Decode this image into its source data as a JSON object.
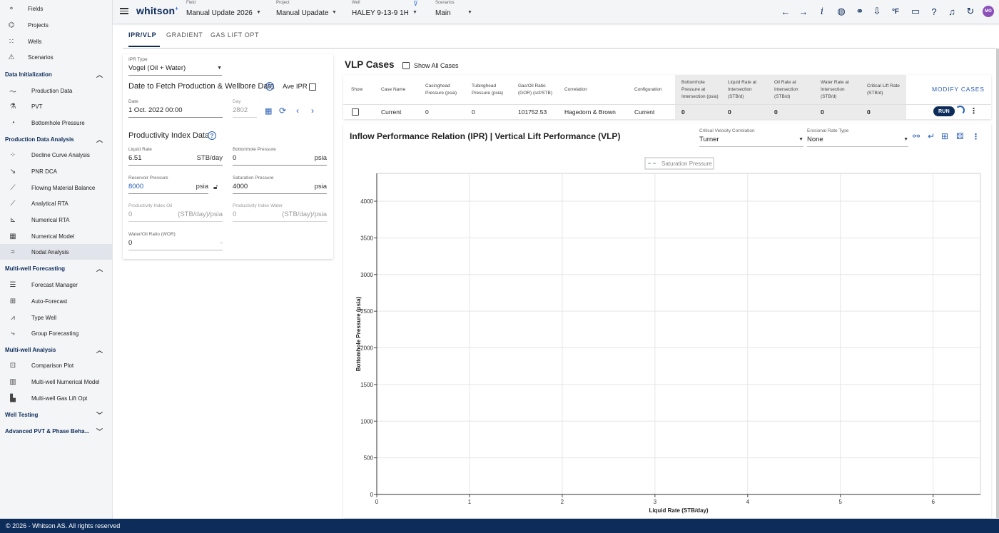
{
  "app": {
    "logo": "whitson",
    "logo_sup": "+"
  },
  "sidebar": {
    "items": [
      {
        "label": "Fields",
        "icon": "nodes-icon",
        "glyph": "⚬"
      },
      {
        "label": "Projects",
        "icon": "network-icon",
        "glyph": "⌬"
      },
      {
        "label": "Wells",
        "icon": "grid-dots-icon",
        "glyph": "⁙"
      },
      {
        "label": "Scenarios",
        "icon": "tree-icon",
        "glyph": "⚠"
      }
    ],
    "sections": [
      {
        "label": "Data Initialization",
        "expanded": true,
        "items": [
          {
            "label": "Production Data",
            "icon": "trend-icon",
            "glyph": "〜"
          },
          {
            "label": "PVT",
            "icon": "flask-icon",
            "glyph": "⚗"
          },
          {
            "label": "Bottomhole Pressure",
            "icon": "gauge-icon",
            "glyph": "◔"
          }
        ]
      },
      {
        "label": "Production Data Analysis",
        "expanded": true,
        "items": [
          {
            "label": "Decline Curve Analysis",
            "icon": "scatter-icon",
            "glyph": "⁘"
          },
          {
            "label": "PNR DCA",
            "icon": "decline-icon",
            "glyph": "↘"
          },
          {
            "label": "Flowing Material Balance",
            "icon": "chart-icon",
            "glyph": "⟋"
          },
          {
            "label": "Analytical RTA",
            "icon": "line-icon",
            "glyph": "⟋"
          },
          {
            "label": "Numerical RTA",
            "icon": "axes-icon",
            "glyph": "⊾"
          },
          {
            "label": "Numerical Model",
            "icon": "building-icon",
            "glyph": "▦"
          },
          {
            "label": "Nodal Analysis",
            "icon": "nodal-icon",
            "glyph": "≈"
          }
        ]
      },
      {
        "label": "Multi-well Forecasting",
        "expanded": true,
        "items": [
          {
            "label": "Forecast Manager",
            "icon": "list-icon",
            "glyph": "☰"
          },
          {
            "label": "Auto-Forecast",
            "icon": "grid-icon",
            "glyph": "⊞"
          },
          {
            "label": "Type Well",
            "icon": "typewell-icon",
            "glyph": "⩘"
          },
          {
            "label": "Group Forecasting",
            "icon": "group-icon",
            "glyph": "⤷"
          }
        ]
      },
      {
        "label": "Multi-well Analysis",
        "expanded": true,
        "items": [
          {
            "label": "Comparison Plot",
            "icon": "compare-icon",
            "glyph": "⊡"
          },
          {
            "label": "Multi-well Numerical Model",
            "icon": "model-icon",
            "glyph": "▥"
          },
          {
            "label": "Multi-well Gas Lift Opt",
            "icon": "gaslift-icon",
            "glyph": "▙"
          }
        ]
      },
      {
        "label": "Well Testing",
        "expanded": false,
        "items": []
      },
      {
        "label": "Advanced PVT & Phase Beha...",
        "expanded": false,
        "items": []
      }
    ],
    "active": "Nodal Analysis"
  },
  "topbar": {
    "field": {
      "caption": "Field",
      "value": "Manual Update 2026"
    },
    "project": {
      "caption": "Project",
      "value": "Manual Upadate"
    },
    "well": {
      "caption": "Well",
      "value": "HALEY 9-13-9 1H"
    },
    "scenario": {
      "caption": "Scenarios",
      "value": "Main"
    },
    "user_initials": "MO",
    "icons": [
      "arrow-left-icon",
      "arrow-right-icon",
      "info-icon",
      "globe-icon",
      "link-icon",
      "download-icon",
      "unit-icon",
      "feedback-icon",
      "help-icon",
      "bell-icon",
      "refresh-icon"
    ],
    "unit_label": "°F"
  },
  "tabs": [
    {
      "label": "IPR/VLP",
      "active": true
    },
    {
      "label": "GRADIENT",
      "active": false
    },
    {
      "label": "GAS LIFT OPT",
      "active": false
    }
  ],
  "ipr": {
    "ipr_type": {
      "caption": "IPR Type",
      "value": "Vogel (Oil + Water)"
    },
    "fetch_title": "Date to Fetch Production & Wellbore Data",
    "ave_ipr_label": "Ave IPR",
    "date": {
      "caption": "Date",
      "value": "1 Oct. 2022 00:00"
    },
    "day": {
      "caption": "Day",
      "value": "2802"
    },
    "pi_title": "Productivity Index Data",
    "liquid_rate": {
      "caption": "Liquid Rate",
      "value": "6.51",
      "unit": "STB/day"
    },
    "bhp": {
      "caption": "Bottomhole Pressure",
      "value": "0",
      "unit": "psia"
    },
    "reservoir_pressure": {
      "caption": "Reservoir Pressure",
      "value": "8000",
      "unit": "psia"
    },
    "saturation_pressure": {
      "caption": "Saturation Pressure",
      "value": "4000",
      "unit": "psia"
    },
    "pi_oil": {
      "caption": "Productivity Index Oil",
      "value": "0",
      "unit": "(STB/day)/psia"
    },
    "pi_water": {
      "caption": "Productivity Index Water",
      "value": "0",
      "unit": "(STB/day)/psia"
    },
    "wor": {
      "caption": "Water/Oil Ratio (WOR)",
      "value": "0",
      "unit": "-"
    }
  },
  "vlp": {
    "title": "VLP Cases",
    "show_all_label": "Show All Cases",
    "modify_label": "MODIFY CASES",
    "run_label": "RUN",
    "columns": [
      {
        "label": "Show"
      },
      {
        "label": "Case Name"
      },
      {
        "label": "Casinghead Pressure (psia)"
      },
      {
        "label": "Tubinghead Pressure (psia)"
      },
      {
        "label": "Gas/Oil Ratio (GOR) (scf/STB)"
      },
      {
        "label": "Correlation"
      },
      {
        "label": "Configuration"
      },
      {
        "label": "Bottomhole Pressure at Intersection (psia)"
      },
      {
        "label": "Liquid Rate at Intersection (STB/d)"
      },
      {
        "label": "Oil Rate at Intersection (STB/d)"
      },
      {
        "label": "Water Rate at Intersection (STB/d)"
      },
      {
        "label": "Critical Lift Rate (STB/d)"
      }
    ],
    "row": {
      "case_name": "Current",
      "casinghead": "0",
      "tubinghead": "0",
      "gor": "101752.53",
      "correlation": "Hagedorn & Brown",
      "configuration": "Current",
      "bhp_int": "0",
      "liq_int": "0",
      "oil_int": "0",
      "water_int": "0",
      "crit_lift": "0"
    }
  },
  "chart_panel": {
    "title": "Inflow Performance Relation (IPR) | Vertical Lift Performance (VLP)",
    "crit_velocity": {
      "caption": "Critical Velocity Correlation",
      "value": "Turner"
    },
    "erosional": {
      "caption": "Erosional Rate Type",
      "value": "None"
    },
    "tool_icons": [
      "hierarchy-icon",
      "enter-icon",
      "table-icon",
      "dice-icon",
      "more-vertical-icon"
    ]
  },
  "chart_data": {
    "type": "line",
    "title": "",
    "xlabel": "Liquid Rate (STB/day)",
    "ylabel": "Bottomhole Pressure (psia)",
    "xlim": [
      0,
      6.51
    ],
    "ylim": [
      0,
      4000
    ],
    "x_ticks": [
      0,
      1,
      2,
      3,
      4,
      5,
      6
    ],
    "y_ticks": [
      0,
      500,
      1000,
      1500,
      2000,
      2500,
      3000,
      3500,
      4000
    ],
    "grid": true,
    "legend_position": "top-center",
    "series": [
      {
        "name": "Saturation Pressure",
        "style": "dashed",
        "color": "#9aa0a6",
        "x": [],
        "y": []
      }
    ]
  },
  "footer": {
    "text": "© 2026 - Whitson AS. All rights reserved"
  }
}
